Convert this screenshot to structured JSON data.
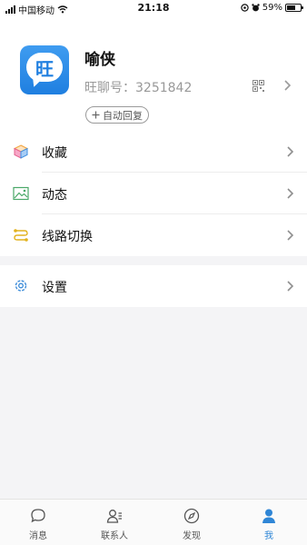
{
  "status_bar": {
    "carrier": "中国移动",
    "time": "21:18",
    "battery": "59%",
    "battery_level": 0.59
  },
  "profile": {
    "avatar_char": "旺",
    "name": "喻侠",
    "id_text": "旺聊号：3251842",
    "auto_reply": "自动回复"
  },
  "menu": {
    "favorites": "收藏",
    "moments": "动态",
    "line_switch": "线路切换",
    "settings": "设置"
  },
  "tabs": {
    "messages": "消息",
    "contacts": "联系人",
    "discover": "发现",
    "me": "我"
  },
  "colors": {
    "accent": "#2f86d6",
    "avatar_blue": "#1f7fe0"
  }
}
